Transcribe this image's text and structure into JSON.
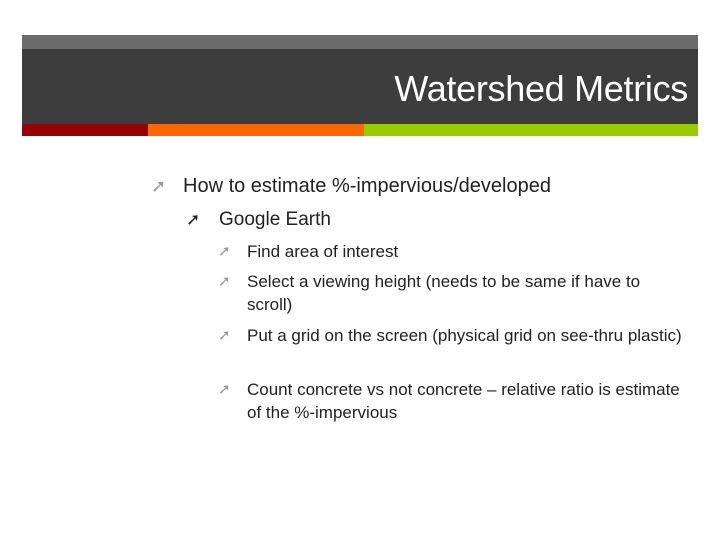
{
  "slide": {
    "title": "Watershed Metrics",
    "colors": {
      "header_top": "#6b6b6b",
      "header_main": "#3d3d3d",
      "strip_red": "#990000",
      "strip_orange": "#ff6600",
      "strip_green": "#99cc00"
    },
    "bullet_icon": "north-east-arrow-icon",
    "bullets": {
      "level1": "How to estimate %-impervious/developed",
      "level2": "Google Earth",
      "level3": [
        "Find area of interest",
        "Select a viewing height (needs to be same if have to scroll)",
        "Put a grid on the screen (physical grid on see-thru plastic)",
        "Count concrete vs not concrete – relative ratio is estimate of the %-impervious"
      ]
    }
  }
}
